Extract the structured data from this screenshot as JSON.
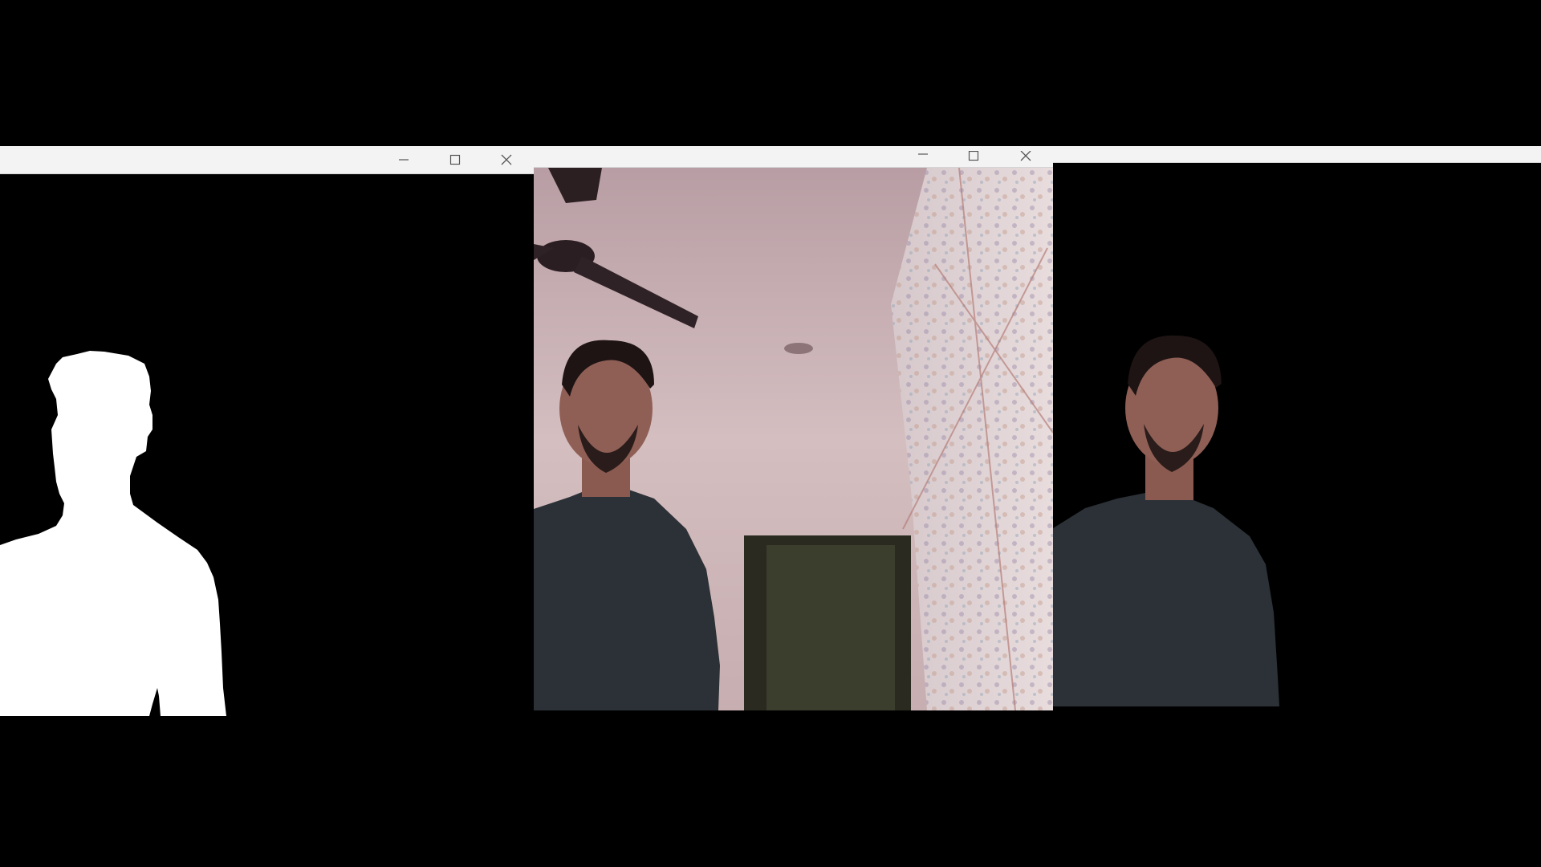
{
  "windows": [
    {
      "id": "mask-window",
      "content": "white-silhouette-mask-on-black",
      "controls": [
        "minimize-icon",
        "maximize-icon",
        "close-icon"
      ]
    },
    {
      "id": "camera-window",
      "content": "webcam-frame-person-in-room",
      "controls": [
        "minimize-icon",
        "maximize-icon",
        "close-icon"
      ]
    },
    {
      "id": "output-window",
      "content": "segmented-person-on-black",
      "controls": []
    }
  ],
  "colors": {
    "titlebar": "#f3f3f3",
    "desktop": "#000000",
    "mask": "#ffffff",
    "room_wall": "#cdb6b9",
    "shirt": "#2b3136",
    "skin": "#8f5f55",
    "hair": "#1e1414"
  }
}
